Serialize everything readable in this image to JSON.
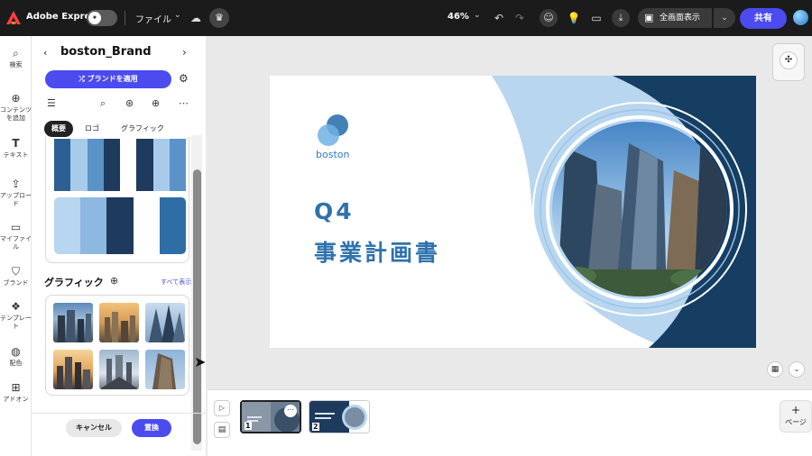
{
  "topbar": {
    "app_name": "Adobe Express",
    "file_menu": "ファイル",
    "zoom": "46%",
    "present_label": "全画面表示",
    "share_label": "共有"
  },
  "rail": [
    {
      "label": "検索",
      "icon": "search-icon"
    },
    {
      "label": "コンテンツを追加",
      "icon": "add-icon"
    },
    {
      "label": "テキスト",
      "icon": "text-icon"
    },
    {
      "label": "アップロード",
      "icon": "upload-icon"
    },
    {
      "label": "マイファイル",
      "icon": "folder-icon"
    },
    {
      "label": "ブランド",
      "icon": "brand-icon"
    },
    {
      "label": "テンプレート",
      "icon": "template-icon"
    },
    {
      "label": "配色",
      "icon": "palette-icon"
    },
    {
      "label": "アドオン",
      "icon": "addon-icon"
    }
  ],
  "panel": {
    "title": "boston_Brand",
    "apply_label": "ブランドを適用",
    "tabs": [
      "概要",
      "ロゴ",
      "グラフィック"
    ],
    "graphics_heading": "グラフィック",
    "see_all": "すべて表示",
    "cancel_label": "キャンセル",
    "replace_label": "置換"
  },
  "palette": {
    "row_a": [
      "#2c5f93",
      "#a8cbea",
      "#5b92c8",
      "#1e3a5c",
      "#ffffff",
      "#1e3a5c",
      "#a8cbea",
      "#5b92c8"
    ],
    "row_b": [
      "#b9d6f0",
      "#8db8e0",
      "#1e3a5c",
      "#ffffff",
      "#2f6da6"
    ]
  },
  "slide": {
    "logo_text": "boston",
    "heading_line1": "Q4",
    "heading_line2": "事業計画書",
    "accent_dark": "#153e62",
    "accent_light": "#b8d6ef",
    "text_blue": "#2f72ad"
  },
  "pages": [
    {
      "number": "1"
    },
    {
      "number": "2"
    }
  ],
  "bottom": {
    "add_page_label": "ページ"
  }
}
